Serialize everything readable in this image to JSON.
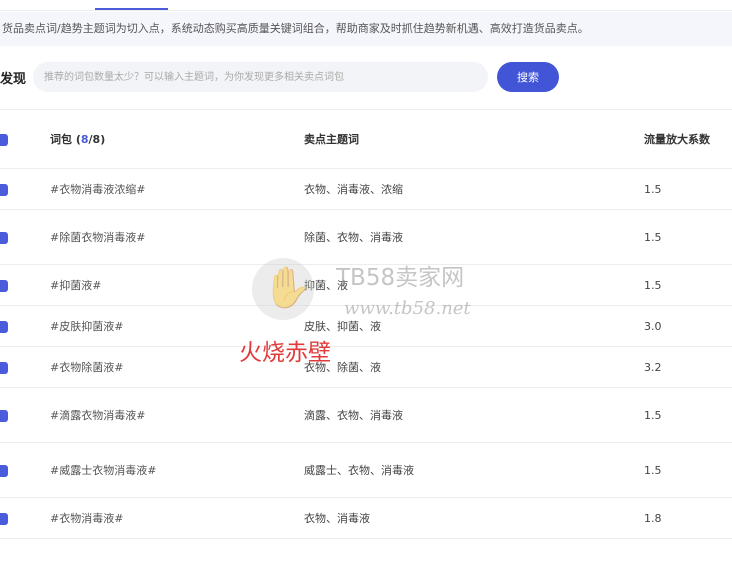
{
  "banner": {
    "text": "货品卖点词/趋势主题词为切入点，系统动态购买高质量关键词组合，帮助商家及时抓住趋势新机遇、高效打造货品卖点。"
  },
  "search": {
    "label": "发现",
    "placeholder": "推荐的词包数量太少？可以输入主题词，为你发现更多相关卖点词包",
    "button_label": "搜索"
  },
  "table": {
    "header": {
      "words_label": "词包",
      "count_open": "(",
      "count_selected": "8",
      "count_rest": "/8)",
      "topic_label": "卖点主题词",
      "factor_label": "流量放大系数"
    },
    "rows": [
      {
        "keyword": "#衣物消毒液浓缩#",
        "topic": "衣物、消毒液、浓缩",
        "factor": "1.5"
      },
      {
        "keyword": "#除菌衣物消毒液#",
        "topic": "除菌、衣物、消毒液",
        "factor": "1.5"
      },
      {
        "keyword": "#抑菌液#",
        "topic": "抑菌、液",
        "factor": "1.5"
      },
      {
        "keyword": "#皮肤抑菌液#",
        "topic": "皮肤、抑菌、液",
        "factor": "3.0"
      },
      {
        "keyword": "#衣物除菌液#",
        "topic": "衣物、除菌、液",
        "factor": "3.2"
      },
      {
        "keyword": "#滴露衣物消毒液#",
        "topic": "滴露、衣物、消毒液",
        "factor": "1.5"
      },
      {
        "keyword": "#威露士衣物消毒液#",
        "topic": "威露士、衣物、消毒液",
        "factor": "1.5"
      },
      {
        "keyword": "#衣物消毒液#",
        "topic": "衣物、消毒液",
        "factor": "1.8"
      }
    ]
  },
  "watermark": {
    "brand": "TB58卖家网",
    "url": "www.tb58.net",
    "signature": "火烧赤壁"
  },
  "colors": {
    "accent": "#4a5bdc",
    "button": "#4155d6",
    "banner_bg": "#f5f6fb",
    "signature": "#e03b3b"
  },
  "icons": {
    "checkbox": "checked-checkbox-icon",
    "watermark_logo": "hand-icon"
  }
}
